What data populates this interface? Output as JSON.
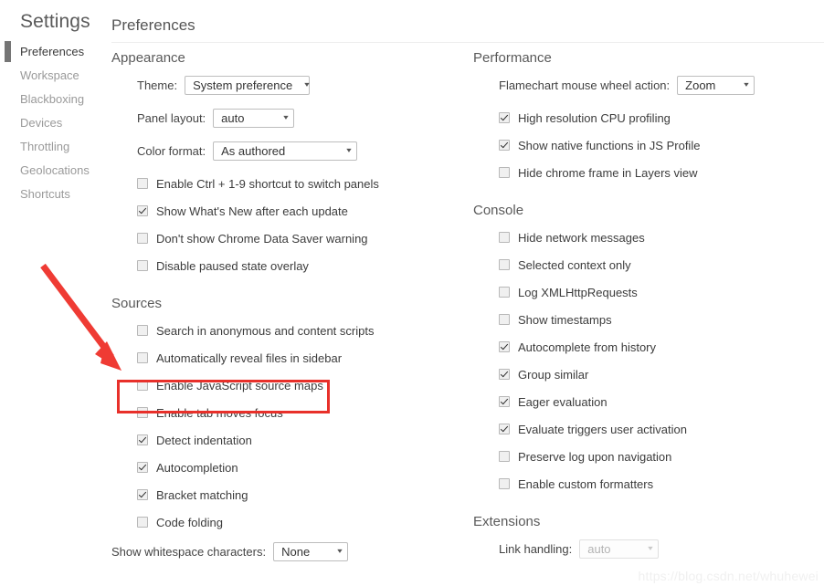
{
  "sidebar": {
    "title": "Settings",
    "items": [
      {
        "label": "Preferences",
        "selected": true
      },
      {
        "label": "Workspace",
        "selected": false
      },
      {
        "label": "Blackboxing",
        "selected": false
      },
      {
        "label": "Devices",
        "selected": false
      },
      {
        "label": "Throttling",
        "selected": false
      },
      {
        "label": "Geolocations",
        "selected": false
      },
      {
        "label": "Shortcuts",
        "selected": false
      }
    ]
  },
  "page": {
    "title": "Preferences"
  },
  "appearance": {
    "title": "Appearance",
    "theme": {
      "label": "Theme:",
      "value": "System preference"
    },
    "panel_layout": {
      "label": "Panel layout:",
      "value": "auto"
    },
    "color_format": {
      "label": "Color format:",
      "value": "As authored"
    },
    "checkboxes": [
      {
        "label": "Enable Ctrl + 1-9 shortcut to switch panels",
        "checked": false
      },
      {
        "label": "Show What's New after each update",
        "checked": true
      },
      {
        "label": "Don't show Chrome Data Saver warning",
        "checked": false
      },
      {
        "label": "Disable paused state overlay",
        "checked": false
      }
    ]
  },
  "sources": {
    "title": "Sources",
    "checkboxes": [
      {
        "label": "Search in anonymous and content scripts",
        "checked": false
      },
      {
        "label": "Automatically reveal files in sidebar",
        "checked": false
      },
      {
        "label": "Enable JavaScript source maps",
        "checked": false,
        "highlighted": true
      },
      {
        "label": "Enable tab moves focus",
        "checked": false
      },
      {
        "label": "Detect indentation",
        "checked": true
      },
      {
        "label": "Autocompletion",
        "checked": true
      },
      {
        "label": "Bracket matching",
        "checked": true
      },
      {
        "label": "Code folding",
        "checked": false
      }
    ],
    "whitespace": {
      "label": "Show whitespace characters:",
      "value": "None"
    }
  },
  "performance": {
    "title": "Performance",
    "flamechart": {
      "label": "Flamechart mouse wheel action:",
      "value": "Zoom"
    },
    "checkboxes": [
      {
        "label": "High resolution CPU profiling",
        "checked": true
      },
      {
        "label": "Show native functions in JS Profile",
        "checked": true
      },
      {
        "label": "Hide chrome frame in Layers view",
        "checked": false
      }
    ]
  },
  "console": {
    "title": "Console",
    "checkboxes": [
      {
        "label": "Hide network messages",
        "checked": false
      },
      {
        "label": "Selected context only",
        "checked": false
      },
      {
        "label": "Log XMLHttpRequests",
        "checked": false
      },
      {
        "label": "Show timestamps",
        "checked": false
      },
      {
        "label": "Autocomplete from history",
        "checked": true
      },
      {
        "label": "Group similar",
        "checked": true
      },
      {
        "label": "Eager evaluation",
        "checked": true
      },
      {
        "label": "Evaluate triggers user activation",
        "checked": true
      },
      {
        "label": "Preserve log upon navigation",
        "checked": false
      },
      {
        "label": "Enable custom formatters",
        "checked": false
      }
    ]
  },
  "extensions": {
    "title": "Extensions",
    "link_handling": {
      "label": "Link handling:",
      "value": "auto",
      "disabled": true
    }
  },
  "annotations": {
    "highlight_color": "#e8302a",
    "arrow_color": "#ef3b34"
  },
  "watermark": {
    "text": "https://blog.csdn.net/whuhewei"
  },
  "icons": {
    "caret": "▾"
  }
}
